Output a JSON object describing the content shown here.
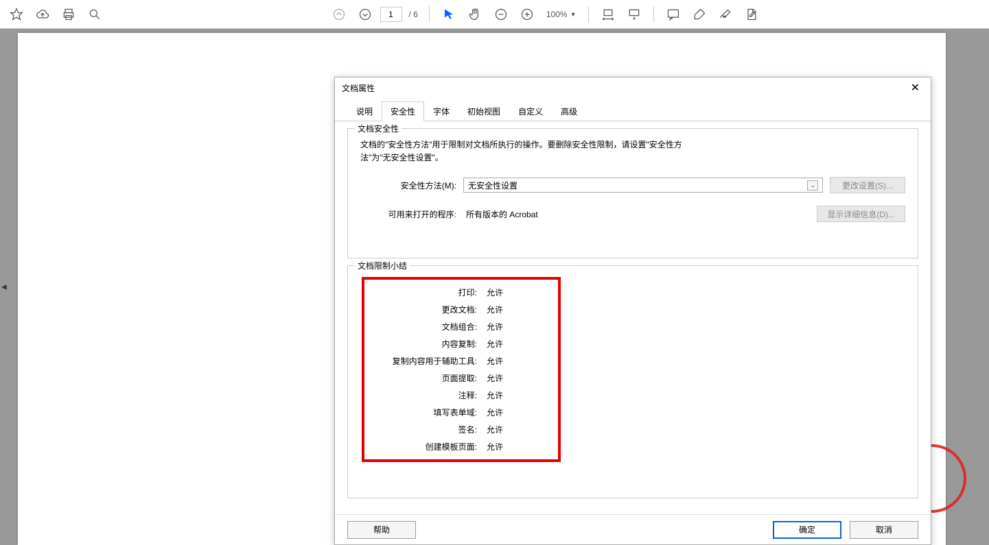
{
  "toolbar": {
    "page_current": "1",
    "page_total": "/ 6",
    "zoom": "100%"
  },
  "dialog": {
    "title": "文档属性",
    "tabs": [
      "说明",
      "安全性",
      "字体",
      "初始视图",
      "自定义",
      "高级"
    ],
    "active_tab_index": 1,
    "security_section": {
      "legend": "文档安全性",
      "description": "文档的\"安全性方法\"用于限制对文档所执行的操作。要删除安全性限制，请设置\"安全性方法\"为\"无安全性设置\"。",
      "method_label": "安全性方法(M):",
      "method_value": "无安全性设置",
      "change_settings_btn": "更改设置(S)...",
      "open_with_label": "可用来打开的程序:",
      "open_with_value": "所有版本的 Acrobat",
      "show_details_btn": "显示详细信息(D)..."
    },
    "restrictions_section": {
      "legend": "文档限制小结",
      "items": [
        {
          "label": "打印:",
          "value": "允许"
        },
        {
          "label": "更改文档:",
          "value": "允许"
        },
        {
          "label": "文档组合:",
          "value": "允许"
        },
        {
          "label": "内容复制:",
          "value": "允许"
        },
        {
          "label": "复制内容用于辅助工具:",
          "value": "允许"
        },
        {
          "label": "页面提取:",
          "value": "允许"
        },
        {
          "label": "注释:",
          "value": "允许"
        },
        {
          "label": "填写表单域:",
          "value": "允许"
        },
        {
          "label": "签名:",
          "value": "允许"
        },
        {
          "label": "创建模板页面:",
          "value": "允许"
        }
      ]
    },
    "footer": {
      "help": "帮助",
      "ok": "确定",
      "cancel": "取消"
    }
  }
}
